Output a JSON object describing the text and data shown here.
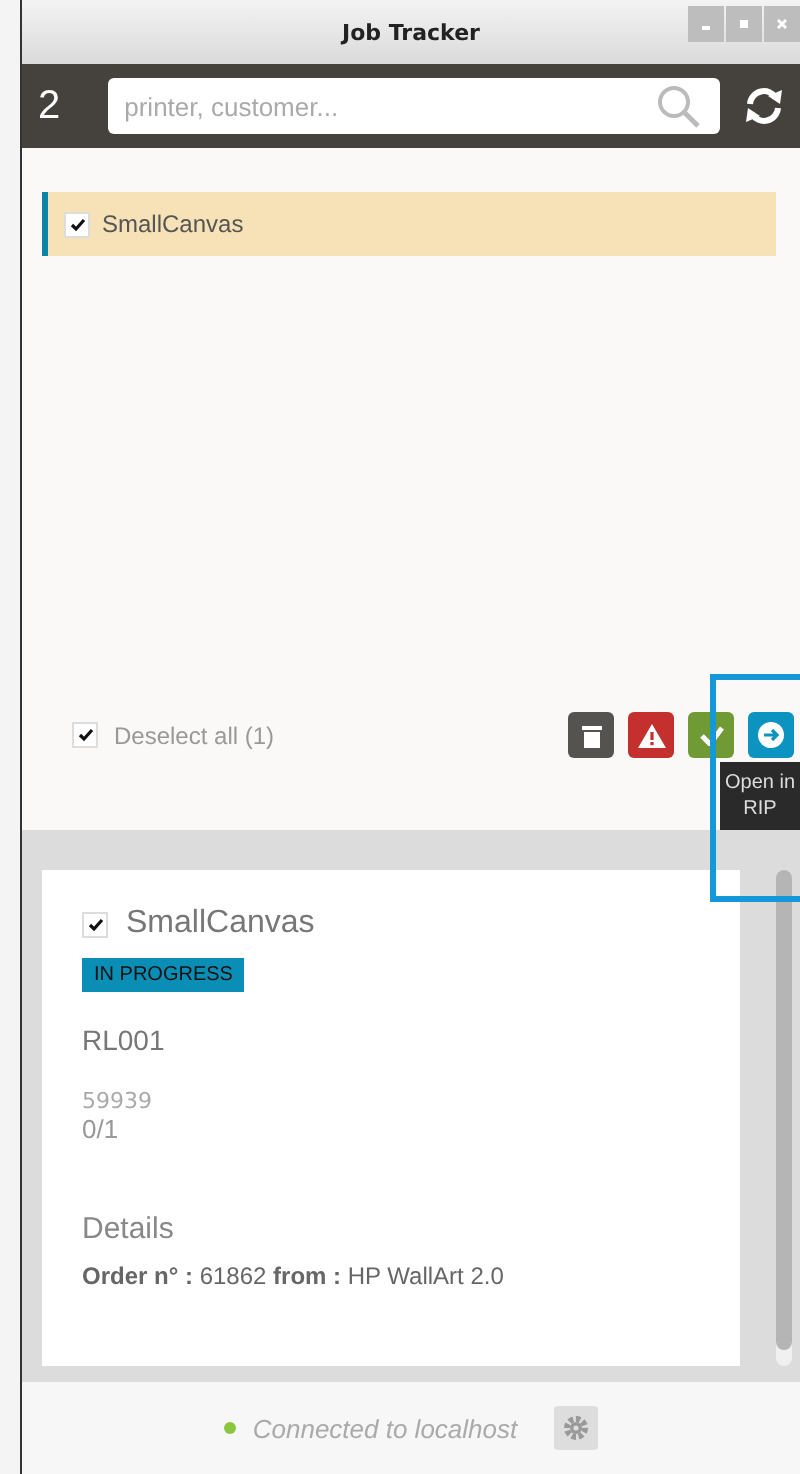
{
  "window": {
    "title": "Job Tracker"
  },
  "header": {
    "count": "2",
    "search": {
      "placeholder": "printer, customer..."
    }
  },
  "jobs": [
    {
      "name": "SmallCanvas",
      "checked": true,
      "selected": true
    }
  ],
  "deselect": {
    "label": "Deselect all (1)",
    "checked": true
  },
  "actions": [
    {
      "kind": "delete"
    },
    {
      "kind": "warning"
    },
    {
      "kind": "approve"
    },
    {
      "kind": "open"
    }
  ],
  "tooltip": {
    "text": "Open in RIP"
  },
  "detail": {
    "checked": true,
    "name": "SmallCanvas",
    "status": "IN PROGRESS",
    "code": "RL001",
    "number": "59939",
    "progress": "0/1",
    "heading": "Details",
    "order": "**Order n° :** 61862 **from :** HP WallArt 2.0"
  },
  "status_bar": {
    "text": "Connected to localhost",
    "connected": true
  }
}
